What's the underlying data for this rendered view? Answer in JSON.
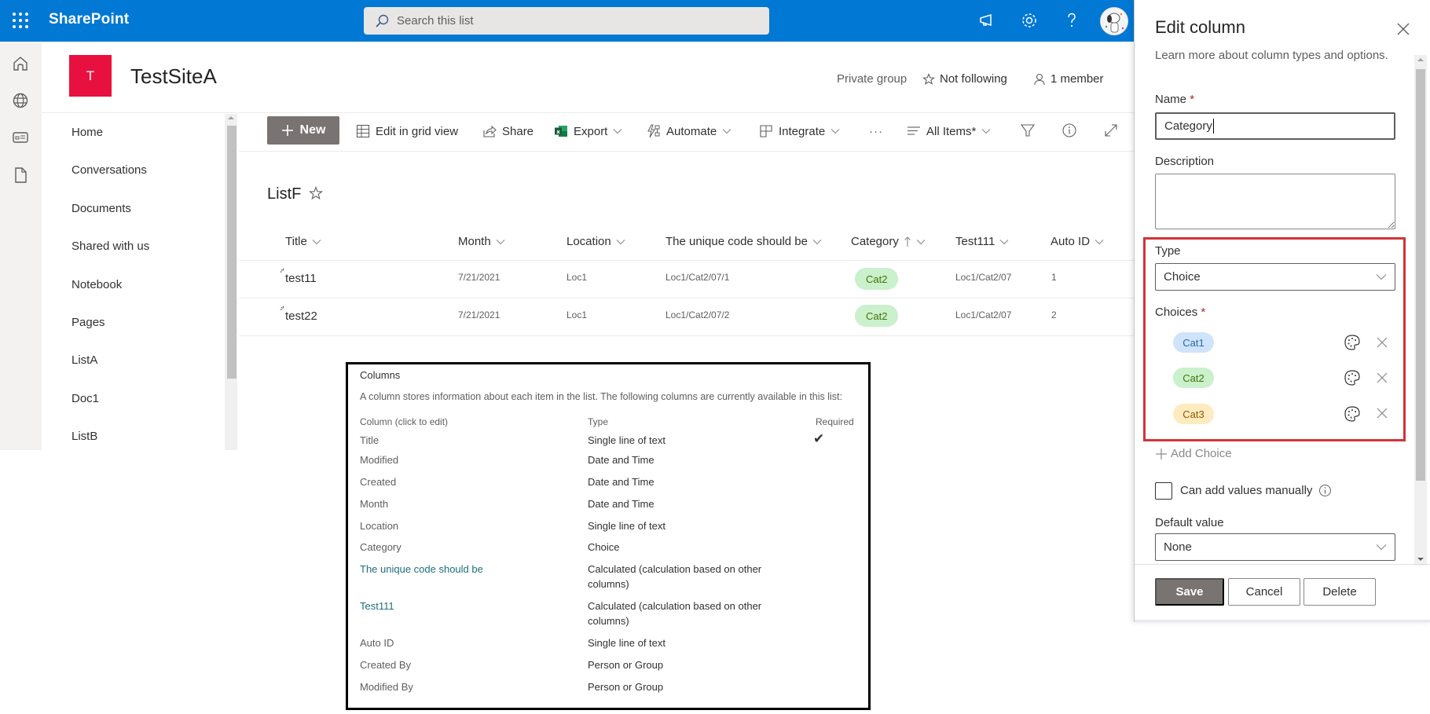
{
  "topbar": {
    "app_name": "SharePoint",
    "search_placeholder": "Search this list"
  },
  "site": {
    "logo_letter": "T",
    "title": "TestSiteA",
    "privacy": "Private group",
    "follow_label": "Not following",
    "members_label": "1 member"
  },
  "leftnav": {
    "items": [
      "Home",
      "Conversations",
      "Documents",
      "Shared with us",
      "Notebook",
      "Pages",
      "ListA",
      "Doc1",
      "ListB"
    ]
  },
  "toolbar": {
    "new_label": "New",
    "grid_label": "Edit in grid view",
    "share_label": "Share",
    "export_label": "Export",
    "automate_label": "Automate",
    "integrate_label": "Integrate",
    "more_label": "···",
    "view_label": "All Items*"
  },
  "list": {
    "title": "ListF",
    "columns": [
      "Title",
      "Month",
      "Location",
      "The unique code should be",
      "Category",
      "Test111",
      "Auto ID"
    ],
    "rows": [
      {
        "title": "test11",
        "month": "7/21/2021",
        "location": "Loc1",
        "code": "Loc1/Cat2/07/1",
        "category": "Cat2",
        "test111": "Loc1/Cat2/07",
        "auto_id": "1"
      },
      {
        "title": "test22",
        "month": "7/21/2021",
        "location": "Loc1",
        "code": "Loc1/Cat2/07/2",
        "category": "Cat2",
        "test111": "Loc1/Cat2/07",
        "auto_id": "2"
      }
    ]
  },
  "columns_box": {
    "heading": "Columns",
    "description": "A column stores information about each item in the list. The following columns are currently available in this list:",
    "col_header": "Column (click to edit)",
    "type_header": "Type",
    "required_header": "Required",
    "rows": [
      {
        "name": "Title",
        "type": "Single line of text",
        "required": "✔"
      },
      {
        "name": "Modified",
        "type": "Date and Time"
      },
      {
        "name": "Created",
        "type": "Date and Time"
      },
      {
        "name": "Month",
        "type": "Date and Time"
      },
      {
        "name": "Location",
        "type": "Single line of text"
      },
      {
        "name": "Category",
        "type": "Choice"
      },
      {
        "name": "The unique code should be",
        "type": "Calculated (calculation based on other",
        "type2": "columns)"
      },
      {
        "name": "Test111",
        "type": "Calculated (calculation based on other",
        "type2": "columns)"
      },
      {
        "name": "Auto ID",
        "type": "Single line of text"
      },
      {
        "name": "Created By",
        "type": "Person or Group"
      },
      {
        "name": "Modified By",
        "type": "Person or Group"
      }
    ]
  },
  "panel": {
    "title": "Edit column",
    "learn_more": "Learn more about column types and options.",
    "name_label": "Name",
    "name_value": "Category",
    "description_label": "Description",
    "description_value": "",
    "type_label": "Type",
    "type_value": "Choice",
    "choices_label": "Choices",
    "choices": [
      {
        "label": "Cat1",
        "bg": "#cfe4fa",
        "fg": "#2b6aa6"
      },
      {
        "label": "Cat2",
        "bg": "#caf0cc",
        "fg": "#437406"
      },
      {
        "label": "Cat3",
        "bg": "#ffebc0",
        "fg": "#8a5b00"
      }
    ],
    "add_choice_label": "Add Choice",
    "manual_label": "Can add values manually",
    "manual_checked": false,
    "default_label": "Default value",
    "default_value": "None",
    "save_label": "Save",
    "cancel_label": "Cancel",
    "delete_label": "Delete"
  },
  "colors": {
    "suite_bar": "#0078d4",
    "site_logo": "#e8103e",
    "highlight": "#d13438",
    "category_pill_bg": "#caf0cc",
    "category_pill_fg": "#437406"
  }
}
